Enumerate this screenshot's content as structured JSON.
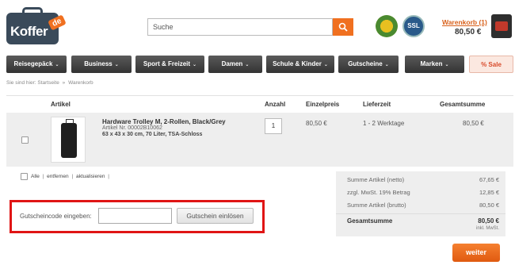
{
  "logo": {
    "text": "Koffer",
    "suffix": "de"
  },
  "search": {
    "placeholder": "Suche"
  },
  "seals": {
    "ssl_label": "SSL"
  },
  "cart": {
    "link": "Warenkorb (1)",
    "total": "80,50 €"
  },
  "nav": {
    "items": [
      "Reisegepäck",
      "Business",
      "Sport & Freizeit",
      "Damen",
      "Schule & Kinder",
      "Gutscheine",
      "Marken"
    ],
    "sale": "% Sale",
    "caret": "⌄"
  },
  "breadcrumb": {
    "prefix": "Sie sind hier:",
    "home": "Startseite",
    "separator": "»",
    "current": "Warenkorb"
  },
  "table": {
    "headers": {
      "article": "Artikel",
      "quantity": "Anzahl",
      "unit_price": "Einzelpreis",
      "delivery": "Lieferzeit",
      "total": "Gesamtsumme"
    },
    "rows": [
      {
        "title": "Hardware Trolley M, 2-Rollen, Black/Grey",
        "article_no": "Artikel Nr. 00002B10062",
        "description": "63 x 43 x 30 cm, 70 Liter, TSA-Schloss",
        "quantity": "1",
        "unit_price": "80,50 €",
        "delivery": "1 - 2 Werktage",
        "total": "80,50 €"
      }
    ]
  },
  "actions": {
    "all": "Alle",
    "remove": "entfernen",
    "update": "aktualisieren",
    "separator": "|"
  },
  "voucher": {
    "label": "Gutscheincode eingeben:",
    "button": "Gutschein einlösen"
  },
  "summary": {
    "rows": [
      {
        "label": "Summe Artikel (netto)",
        "value": "67,65 €"
      },
      {
        "label": "zzgl. MwSt. 19% Betrag",
        "value": "12,85 €"
      },
      {
        "label": "Summe Artikel (brutto)",
        "value": "80,50 €"
      }
    ],
    "total_label": "Gesamtsumme",
    "total_value": "80,50 €",
    "total_note": "inkl. MwSt."
  },
  "continue_button": "weiter",
  "colors": {
    "accent": "#f07020",
    "highlight_border": "#e01515",
    "nav_bg": "#3a3a3a"
  }
}
